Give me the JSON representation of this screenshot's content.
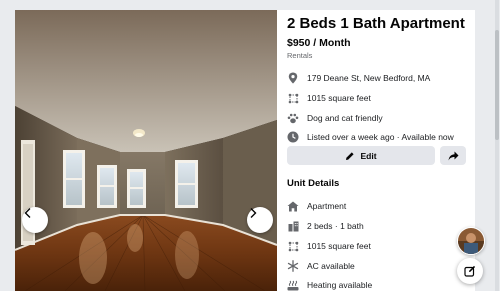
{
  "listing": {
    "title": "2 Beds 1 Bath Apartment",
    "price": "$950 / Month",
    "category": "Rentals",
    "address": "179 Deane St, New Bedford, MA",
    "size": "1015 square feet",
    "pets": "Dog and cat friendly",
    "listed": "Listed over a week ago · Available now"
  },
  "actions": {
    "edit_label": "Edit"
  },
  "unit_details": {
    "heading": "Unit Details",
    "items": [
      {
        "label": "Apartment",
        "icon": "home-icon"
      },
      {
        "label": "2 beds · 1 bath",
        "icon": "building-icon"
      },
      {
        "label": "1015 square feet",
        "icon": "square-feet-icon"
      },
      {
        "label": "AC available",
        "icon": "snowflake-icon"
      },
      {
        "label": "Heating available",
        "icon": "heating-icon"
      }
    ]
  },
  "colors": {
    "icon_gray": "#65676b",
    "button_bg": "#e4e6eb",
    "page_bg": "#e9ebee"
  }
}
